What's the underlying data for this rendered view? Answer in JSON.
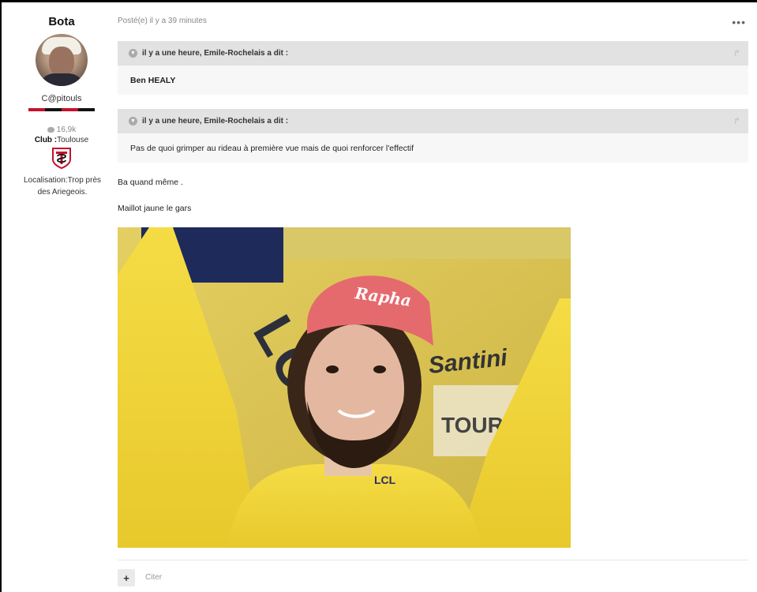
{
  "author": {
    "name": "Bota",
    "rank": "C@pitouls",
    "reputation": "16,9k",
    "club_label": "Club :",
    "club_value": "Toulouse",
    "location_label": "Localisation:",
    "location_value": "Trop près des Ariegeois."
  },
  "post": {
    "meta": "Posté(e) il y a 39 minutes",
    "more_icon": "ellipsis-icon",
    "quotes": [
      {
        "header": "il y a une heure, Emile-Rochelais a dit :",
        "body": "Ben HEALY"
      },
      {
        "header": "il y a une heure, Emile-Rochelais a dit :",
        "body": "Pas de quoi grimper au rideau à première vue mais de quoi renforcer l'effectif"
      }
    ],
    "paragraphs": [
      "Ba quand même .",
      "Maillot jaune le gars"
    ],
    "photo": {
      "cap_text": "Rapha",
      "bg_text": "LCL",
      "bg_text_2": "Santini",
      "jersey_text": "LCL",
      "bg_text_3": "TOUR"
    },
    "actions": {
      "plus_label": "+",
      "cite_label": "Citer"
    }
  },
  "colors": {
    "accent_red": "#c8102e",
    "jersey_yellow": "#f2d338"
  }
}
